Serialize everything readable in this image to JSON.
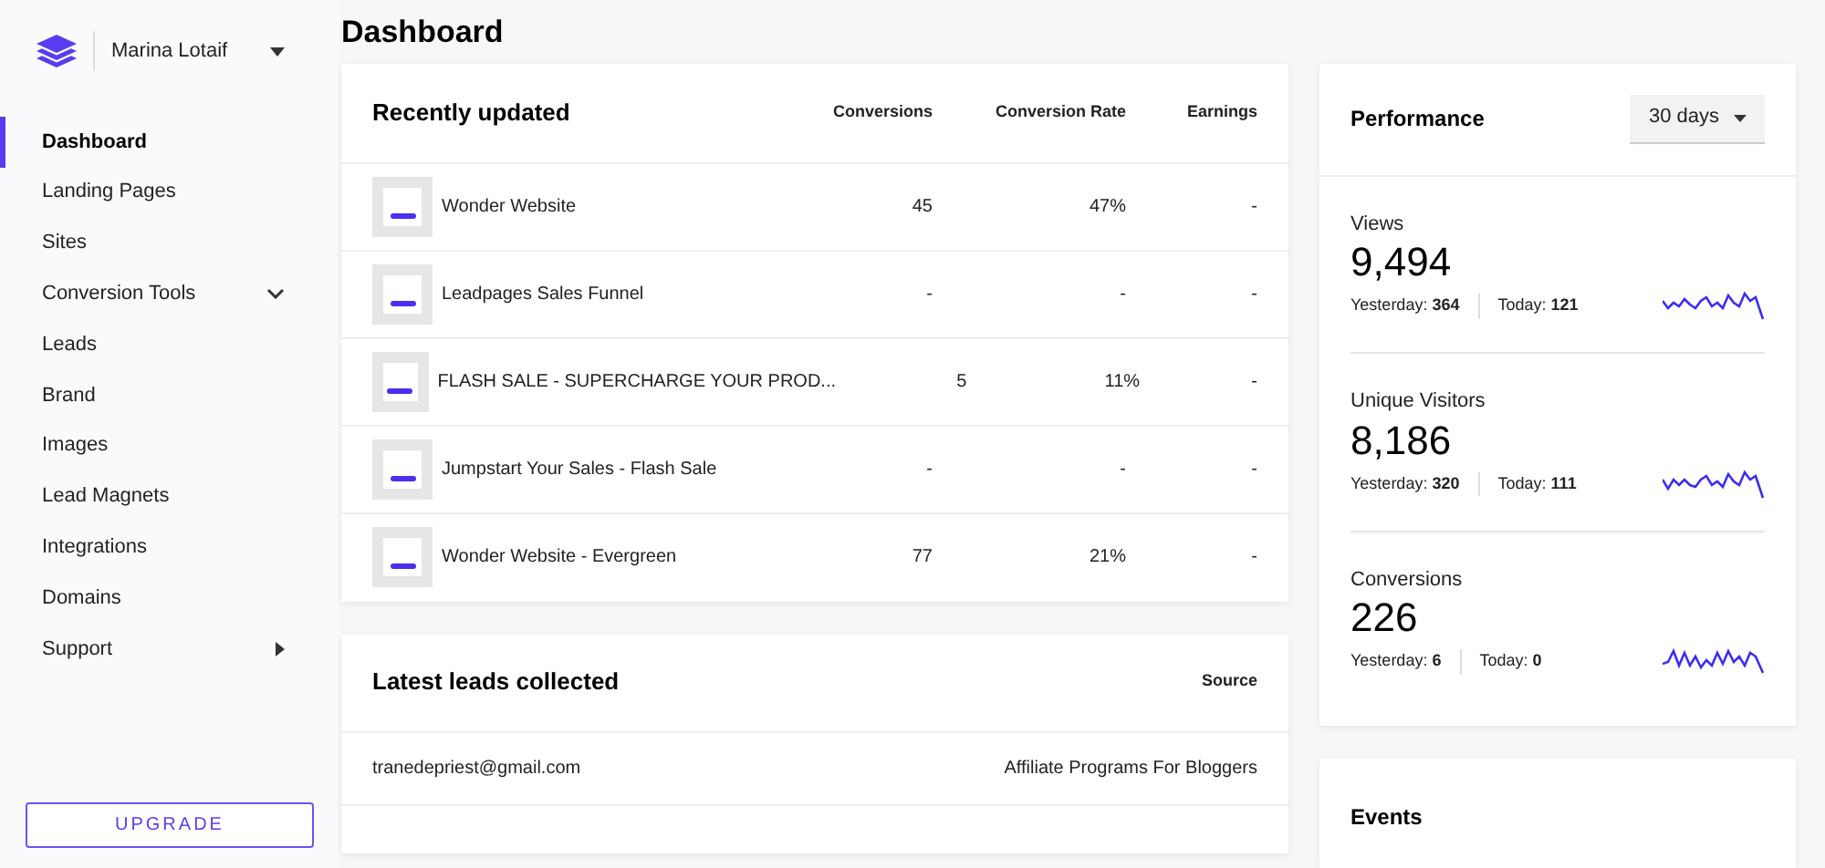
{
  "account": {
    "name": "Marina Lotaif"
  },
  "sidebar": {
    "items": [
      {
        "label": "Dashboard",
        "selected": true,
        "kind": "plain"
      },
      {
        "label": "Landing Pages",
        "selected": false,
        "kind": "plain"
      },
      {
        "label": "Sites",
        "selected": false,
        "kind": "plain"
      },
      {
        "label": "Conversion Tools",
        "selected": false,
        "kind": "dropdown"
      },
      {
        "label": "Leads",
        "selected": false,
        "kind": "plain"
      },
      {
        "label": "Brand",
        "selected": false,
        "kind": "plain"
      },
      {
        "label": "Images",
        "selected": false,
        "kind": "plain"
      },
      {
        "label": "Lead Magnets",
        "selected": false,
        "kind": "plain"
      },
      {
        "label": "Integrations",
        "selected": false,
        "kind": "plain"
      },
      {
        "label": "Domains",
        "selected": false,
        "kind": "plain"
      },
      {
        "label": "Support",
        "selected": false,
        "kind": "submenu"
      }
    ],
    "upgrade_button": "UPGRADE"
  },
  "page_title": "Dashboard",
  "recently_updated": {
    "title": "Recently updated",
    "columns": [
      "Conversions",
      "Conversion Rate",
      "Earnings"
    ],
    "rows": [
      {
        "name": "Wonder Website",
        "conversions": "45",
        "rate": "47%",
        "earnings": "-"
      },
      {
        "name": "Leadpages Sales Funnel",
        "conversions": "-",
        "rate": "-",
        "earnings": "-"
      },
      {
        "name": "FLASH SALE - SUPERCHARGE YOUR PROD...",
        "conversions": "5",
        "rate": "11%",
        "earnings": "-"
      },
      {
        "name": "Jumpstart Your Sales - Flash Sale",
        "conversions": "-",
        "rate": "-",
        "earnings": "-"
      },
      {
        "name": "Wonder Website - Evergreen",
        "conversions": "77",
        "rate": "21%",
        "earnings": "-"
      }
    ]
  },
  "latest_leads": {
    "title": "Latest leads collected",
    "columns": [
      "Source"
    ],
    "rows": [
      {
        "email": "tranedepriest@gmail.com",
        "source": "Affiliate Programs For Bloggers"
      }
    ]
  },
  "performance": {
    "title": "Performance",
    "period": "30 days",
    "metrics": [
      {
        "label": "Views",
        "value": "9,494",
        "yesterday_label": "Yesterday:",
        "yesterday": "364",
        "today_label": "Today:",
        "today": "121"
      },
      {
        "label": "Unique Visitors",
        "value": "8,186",
        "yesterday_label": "Yesterday:",
        "yesterday": "320",
        "today_label": "Today:",
        "today": "111"
      },
      {
        "label": "Conversions",
        "value": "226",
        "yesterday_label": "Yesterday:",
        "yesterday": "6",
        "today_label": "Today:",
        "today": "0"
      }
    ]
  },
  "events": {
    "title": "Events"
  }
}
